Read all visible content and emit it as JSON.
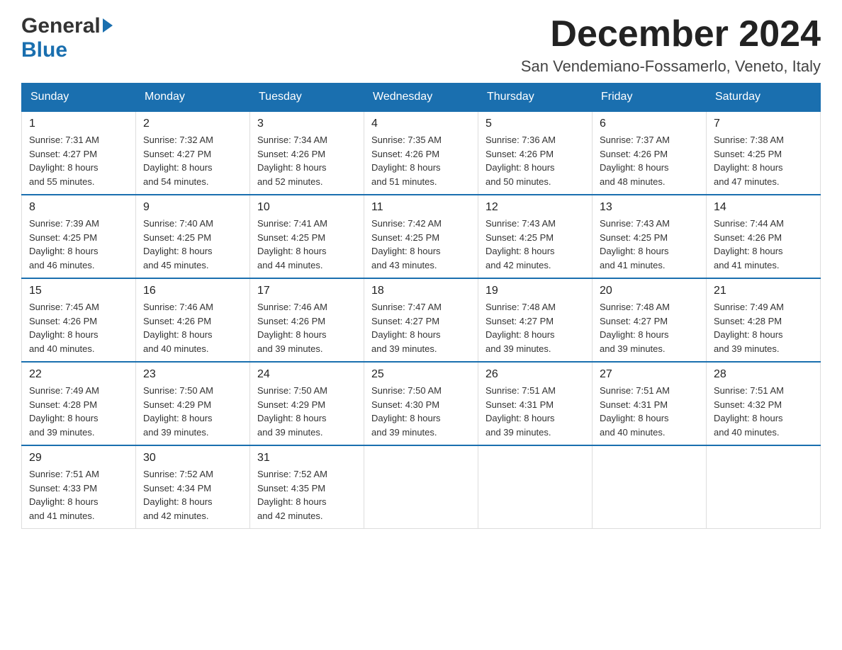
{
  "header": {
    "logo_general": "General",
    "logo_blue": "Blue",
    "month_title": "December 2024",
    "location": "San Vendemiano-Fossamerlo, Veneto, Italy"
  },
  "days_of_week": [
    "Sunday",
    "Monday",
    "Tuesday",
    "Wednesday",
    "Thursday",
    "Friday",
    "Saturday"
  ],
  "weeks": [
    [
      {
        "day": "1",
        "sunrise": "7:31 AM",
        "sunset": "4:27 PM",
        "daylight": "8 hours and 55 minutes."
      },
      {
        "day": "2",
        "sunrise": "7:32 AM",
        "sunset": "4:27 PM",
        "daylight": "8 hours and 54 minutes."
      },
      {
        "day": "3",
        "sunrise": "7:34 AM",
        "sunset": "4:26 PM",
        "daylight": "8 hours and 52 minutes."
      },
      {
        "day": "4",
        "sunrise": "7:35 AM",
        "sunset": "4:26 PM",
        "daylight": "8 hours and 51 minutes."
      },
      {
        "day": "5",
        "sunrise": "7:36 AM",
        "sunset": "4:26 PM",
        "daylight": "8 hours and 50 minutes."
      },
      {
        "day": "6",
        "sunrise": "7:37 AM",
        "sunset": "4:26 PM",
        "daylight": "8 hours and 48 minutes."
      },
      {
        "day": "7",
        "sunrise": "7:38 AM",
        "sunset": "4:25 PM",
        "daylight": "8 hours and 47 minutes."
      }
    ],
    [
      {
        "day": "8",
        "sunrise": "7:39 AM",
        "sunset": "4:25 PM",
        "daylight": "8 hours and 46 minutes."
      },
      {
        "day": "9",
        "sunrise": "7:40 AM",
        "sunset": "4:25 PM",
        "daylight": "8 hours and 45 minutes."
      },
      {
        "day": "10",
        "sunrise": "7:41 AM",
        "sunset": "4:25 PM",
        "daylight": "8 hours and 44 minutes."
      },
      {
        "day": "11",
        "sunrise": "7:42 AM",
        "sunset": "4:25 PM",
        "daylight": "8 hours and 43 minutes."
      },
      {
        "day": "12",
        "sunrise": "7:43 AM",
        "sunset": "4:25 PM",
        "daylight": "8 hours and 42 minutes."
      },
      {
        "day": "13",
        "sunrise": "7:43 AM",
        "sunset": "4:25 PM",
        "daylight": "8 hours and 41 minutes."
      },
      {
        "day": "14",
        "sunrise": "7:44 AM",
        "sunset": "4:26 PM",
        "daylight": "8 hours and 41 minutes."
      }
    ],
    [
      {
        "day": "15",
        "sunrise": "7:45 AM",
        "sunset": "4:26 PM",
        "daylight": "8 hours and 40 minutes."
      },
      {
        "day": "16",
        "sunrise": "7:46 AM",
        "sunset": "4:26 PM",
        "daylight": "8 hours and 40 minutes."
      },
      {
        "day": "17",
        "sunrise": "7:46 AM",
        "sunset": "4:26 PM",
        "daylight": "8 hours and 39 minutes."
      },
      {
        "day": "18",
        "sunrise": "7:47 AM",
        "sunset": "4:27 PM",
        "daylight": "8 hours and 39 minutes."
      },
      {
        "day": "19",
        "sunrise": "7:48 AM",
        "sunset": "4:27 PM",
        "daylight": "8 hours and 39 minutes."
      },
      {
        "day": "20",
        "sunrise": "7:48 AM",
        "sunset": "4:27 PM",
        "daylight": "8 hours and 39 minutes."
      },
      {
        "day": "21",
        "sunrise": "7:49 AM",
        "sunset": "4:28 PM",
        "daylight": "8 hours and 39 minutes."
      }
    ],
    [
      {
        "day": "22",
        "sunrise": "7:49 AM",
        "sunset": "4:28 PM",
        "daylight": "8 hours and 39 minutes."
      },
      {
        "day": "23",
        "sunrise": "7:50 AM",
        "sunset": "4:29 PM",
        "daylight": "8 hours and 39 minutes."
      },
      {
        "day": "24",
        "sunrise": "7:50 AM",
        "sunset": "4:29 PM",
        "daylight": "8 hours and 39 minutes."
      },
      {
        "day": "25",
        "sunrise": "7:50 AM",
        "sunset": "4:30 PM",
        "daylight": "8 hours and 39 minutes."
      },
      {
        "day": "26",
        "sunrise": "7:51 AM",
        "sunset": "4:31 PM",
        "daylight": "8 hours and 39 minutes."
      },
      {
        "day": "27",
        "sunrise": "7:51 AM",
        "sunset": "4:31 PM",
        "daylight": "8 hours and 40 minutes."
      },
      {
        "day": "28",
        "sunrise": "7:51 AM",
        "sunset": "4:32 PM",
        "daylight": "8 hours and 40 minutes."
      }
    ],
    [
      {
        "day": "29",
        "sunrise": "7:51 AM",
        "sunset": "4:33 PM",
        "daylight": "8 hours and 41 minutes."
      },
      {
        "day": "30",
        "sunrise": "7:52 AM",
        "sunset": "4:34 PM",
        "daylight": "8 hours and 42 minutes."
      },
      {
        "day": "31",
        "sunrise": "7:52 AM",
        "sunset": "4:35 PM",
        "daylight": "8 hours and 42 minutes."
      },
      null,
      null,
      null,
      null
    ]
  ],
  "labels": {
    "sunrise": "Sunrise:",
    "sunset": "Sunset:",
    "daylight": "Daylight:"
  }
}
